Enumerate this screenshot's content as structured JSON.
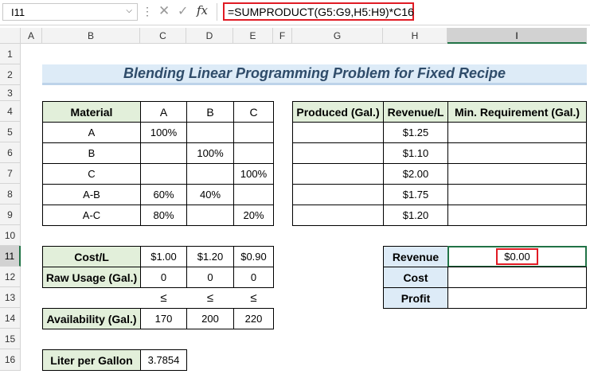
{
  "formula_bar": {
    "name_box": "I11",
    "name_box_arrow": "⌵",
    "dots": "⋮",
    "cancel_icon": "✕",
    "enter_icon": "✓",
    "fx_label": "fx",
    "formula": "=SUMPRODUCT(G5:G9,H5:H9)*C16"
  },
  "columns": [
    "A",
    "B",
    "C",
    "D",
    "E",
    "F",
    "G",
    "H",
    "I"
  ],
  "rows": [
    "1",
    "2",
    "3",
    "4",
    "5",
    "6",
    "7",
    "8",
    "9",
    "10",
    "11",
    "12",
    "13",
    "14",
    "15",
    "16"
  ],
  "title": "Blending Linear Programming Problem for Fixed Recipe",
  "recipe_table": {
    "headers": [
      "Material",
      "A",
      "B",
      "C"
    ],
    "rows": [
      [
        "A",
        "100%",
        "",
        ""
      ],
      [
        "B",
        "",
        "100%",
        ""
      ],
      [
        "C",
        "",
        "",
        "100%"
      ],
      [
        "A-B",
        "60%",
        "40%",
        ""
      ],
      [
        "A-C",
        "80%",
        "",
        "20%"
      ]
    ]
  },
  "production_table": {
    "headers": [
      "Produced (Gal.)",
      "Revenue/L",
      "Min. Requirement (Gal.)"
    ],
    "rows": [
      [
        "",
        "$1.25",
        ""
      ],
      [
        "",
        "$1.10",
        ""
      ],
      [
        "",
        "$2.00",
        ""
      ],
      [
        "",
        "$1.75",
        ""
      ],
      [
        "",
        "$1.20",
        ""
      ]
    ]
  },
  "cost_table": {
    "cost_label": "Cost/L",
    "cost_values": [
      "$1.00",
      "$1.20",
      "$0.90"
    ],
    "usage_label": "Raw Usage (Gal.)",
    "usage_values": [
      "0",
      "0",
      "0"
    ],
    "leq": [
      "≤",
      "≤",
      "≤"
    ],
    "availability_label": "Availability (Gal.)",
    "availability_values": [
      "170",
      "200",
      "220"
    ]
  },
  "summary": {
    "revenue_label": "Revenue",
    "revenue_value": "$0.00",
    "cost_label": "Cost",
    "profit_label": "Profit"
  },
  "conversion": {
    "label": "Liter per Gallon",
    "value": "3.7854"
  },
  "colors": {
    "excel_green": "#217346",
    "highlight_red": "#e01b24",
    "label_green": "#e2efda",
    "label_blue": "#ddebf7"
  }
}
